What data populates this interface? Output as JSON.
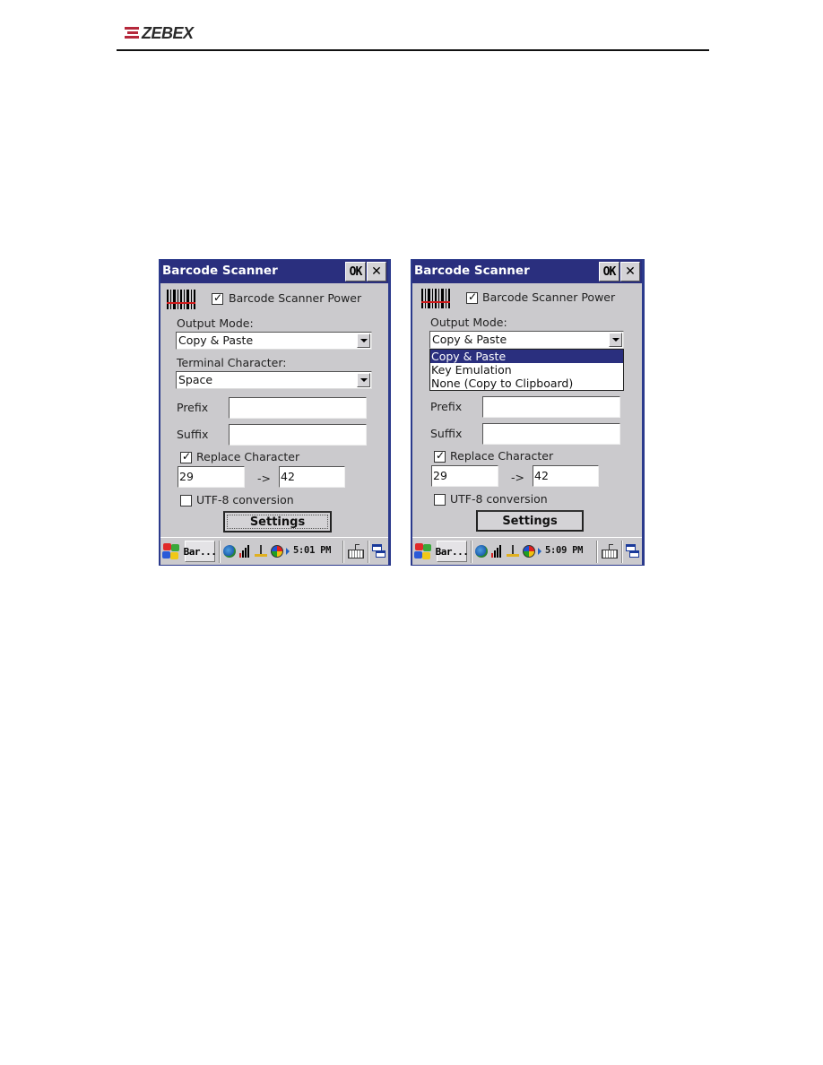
{
  "header": {
    "brand": "ZEBEX"
  },
  "screens": [
    {
      "id": "left",
      "title": "Barcode Scanner",
      "ok_label": "OK",
      "close_label": "✕",
      "icons": {
        "app": "barcode-icon"
      },
      "power": {
        "label": "Barcode Scanner Power",
        "checked": true
      },
      "output_mode": {
        "label": "Output Mode:",
        "value": "Copy & Paste",
        "open": false
      },
      "terminal_character": {
        "label": "Terminal Character:",
        "value": "Space"
      },
      "prefix": {
        "label": "Prefix",
        "value": ""
      },
      "suffix": {
        "label": "Suffix",
        "value": ""
      },
      "replace": {
        "label": "Replace Character",
        "checked": true,
        "from": "29",
        "arrow": "->",
        "to": "42"
      },
      "utf8": {
        "label": "UTF-8 conversion",
        "checked": false
      },
      "settings_label": "Settings",
      "settings_focused": true,
      "taskbar": {
        "task_label": "Bar...",
        "clock": "5:01 PM"
      }
    },
    {
      "id": "right",
      "title": "Barcode Scanner",
      "ok_label": "OK",
      "close_label": "✕",
      "icons": {
        "app": "barcode-icon"
      },
      "power": {
        "label": "Barcode Scanner Power",
        "checked": true
      },
      "output_mode": {
        "label": "Output Mode:",
        "value": "Copy & Paste",
        "open": true,
        "options": [
          "Copy & Paste",
          "Key Emulation",
          "None (Copy to Clipboard)"
        ],
        "selected_index": 0
      },
      "prefix": {
        "label": "Prefix",
        "value": ""
      },
      "suffix": {
        "label": "Suffix",
        "value": ""
      },
      "replace": {
        "label": "Replace Character",
        "checked": true,
        "from": "29",
        "arrow": "->",
        "to": "42"
      },
      "utf8": {
        "label": "UTF-8 conversion",
        "checked": false
      },
      "settings_label": "Settings",
      "settings_focused": false,
      "taskbar": {
        "task_label": "Bar...",
        "clock": "5:09 PM"
      }
    }
  ],
  "colors": {
    "titlebar": "#2a2f7e",
    "window_bg": "#cbcacd",
    "frame": "#2b3a8c",
    "brand_red": "#b5283b",
    "selection": "#2a2f7e"
  }
}
